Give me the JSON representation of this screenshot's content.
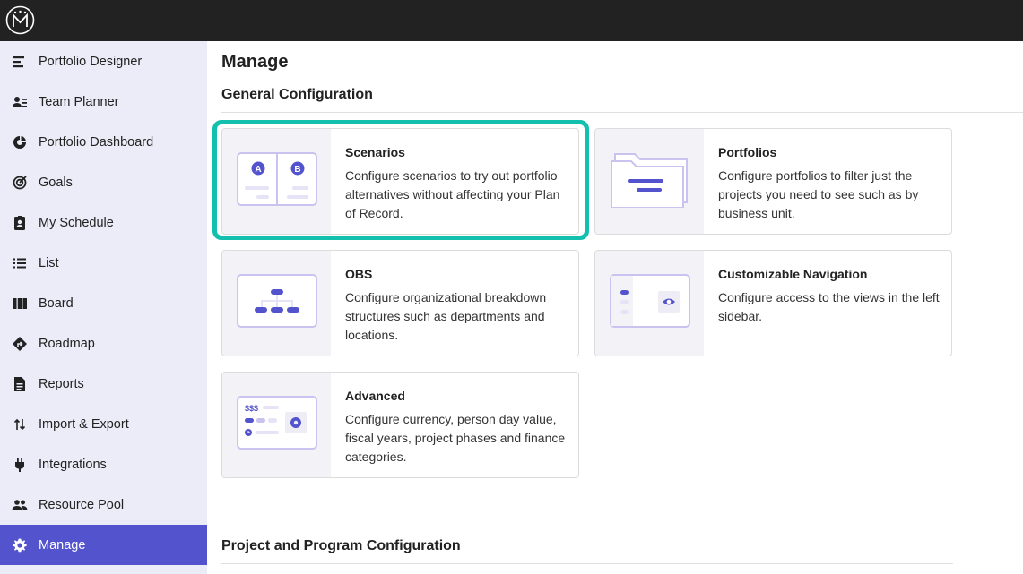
{
  "app": {
    "logo": "m-logo-icon"
  },
  "sidebar": {
    "items": [
      {
        "label": "Portfolio Designer",
        "icon": "portfolio-designer-icon"
      },
      {
        "label": "Team Planner",
        "icon": "team-planner-icon"
      },
      {
        "label": "Portfolio Dashboard",
        "icon": "dashboard-icon"
      },
      {
        "label": "Goals",
        "icon": "goals-icon"
      },
      {
        "label": "My Schedule",
        "icon": "schedule-icon"
      },
      {
        "label": "List",
        "icon": "list-icon"
      },
      {
        "label": "Board",
        "icon": "board-icon"
      },
      {
        "label": "Roadmap",
        "icon": "roadmap-icon"
      },
      {
        "label": "Reports",
        "icon": "reports-icon"
      },
      {
        "label": "Import & Export",
        "icon": "import-export-icon"
      },
      {
        "label": "Integrations",
        "icon": "plug-icon"
      },
      {
        "label": "Resource Pool",
        "icon": "people-icon"
      },
      {
        "label": "Manage",
        "icon": "gear-icon",
        "active": true
      }
    ]
  },
  "main": {
    "title": "Manage",
    "sections": [
      {
        "title": "General Configuration"
      },
      {
        "title": "Project and Program Configuration"
      }
    ],
    "cards": [
      {
        "title": "Scenarios",
        "description": "Configure scenarios to try out portfolio alternatives without affecting your Plan of Record.",
        "highlighted": true
      },
      {
        "title": "Portfolios",
        "description": "Configure portfolios to filter just the projects you need to see such as by business unit."
      },
      {
        "title": "OBS",
        "description": "Configure organizational breakdown structures such as departments and locations."
      },
      {
        "title": "Customizable Navigation",
        "description": "Configure access to the views in the left sidebar."
      },
      {
        "title": "Advanced",
        "description": "Configure currency, person day value, fiscal years, project phases and finance categories.",
        "thumb_text": "$$$"
      }
    ]
  },
  "colors": {
    "accent": "#5353cd",
    "highlight": "#13bfad",
    "topbar": "#222222",
    "sidebar": "#ececf8"
  }
}
